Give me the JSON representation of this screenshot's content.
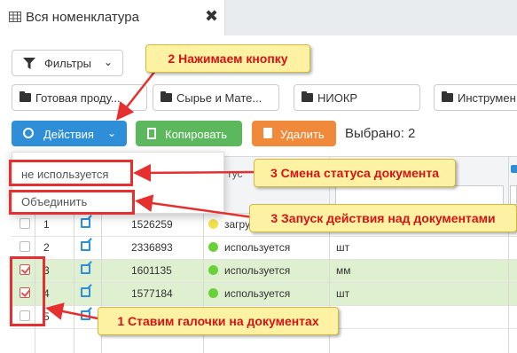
{
  "tab": {
    "title": "Вся номенклатура",
    "close": "✖"
  },
  "toolbar": {
    "filters_label": "Фильтры",
    "folders": [
      "Готовая проду...",
      "Сырье и Мате...",
      "НИОКР",
      "Инструмен"
    ],
    "actions_label": "Действия",
    "copy_label": "Копировать",
    "delete_label": "Удалить",
    "selected_text": "Выбрано: 2"
  },
  "grid": {
    "header_status": "тус",
    "rows": [
      {
        "num": "1",
        "code": "1526259",
        "status": "загру",
        "status_color": "#f5e14a",
        "unit": "",
        "checked": false,
        "bg": "white"
      },
      {
        "num": "2",
        "code": "2336893",
        "status": "используется",
        "status_color": "#6ad13b",
        "unit": "шт",
        "checked": false,
        "bg": "white"
      },
      {
        "num": "3",
        "code": "1601135",
        "status": "используется",
        "status_color": "#6ad13b",
        "unit": "мм",
        "checked": true,
        "bg": "green"
      },
      {
        "num": "4",
        "code": "1577184",
        "status": "используется",
        "status_color": "#6ad13b",
        "unit": "шт",
        "checked": true,
        "bg": "green"
      },
      {
        "num": "5",
        "code": "",
        "status": "",
        "status_color": "#6ad13b",
        "unit": "",
        "checked": false,
        "bg": "white"
      }
    ]
  },
  "dropdown": {
    "items": [
      "не используется",
      "Объединить"
    ]
  },
  "callouts": {
    "c1": "1 Ставим галочки на документах",
    "c2": "2 Нажимаем кнопку",
    "c3": "3 Смена статуса документа",
    "c4": "3 Запуск действия над документами"
  },
  "colors": {
    "primary": "#2e8fd8",
    "success": "#5cb85c",
    "danger": "#f08a3a",
    "callout_bg": "#fdf2a3",
    "callout_text": "#d41414",
    "highlight": "#e53030"
  }
}
